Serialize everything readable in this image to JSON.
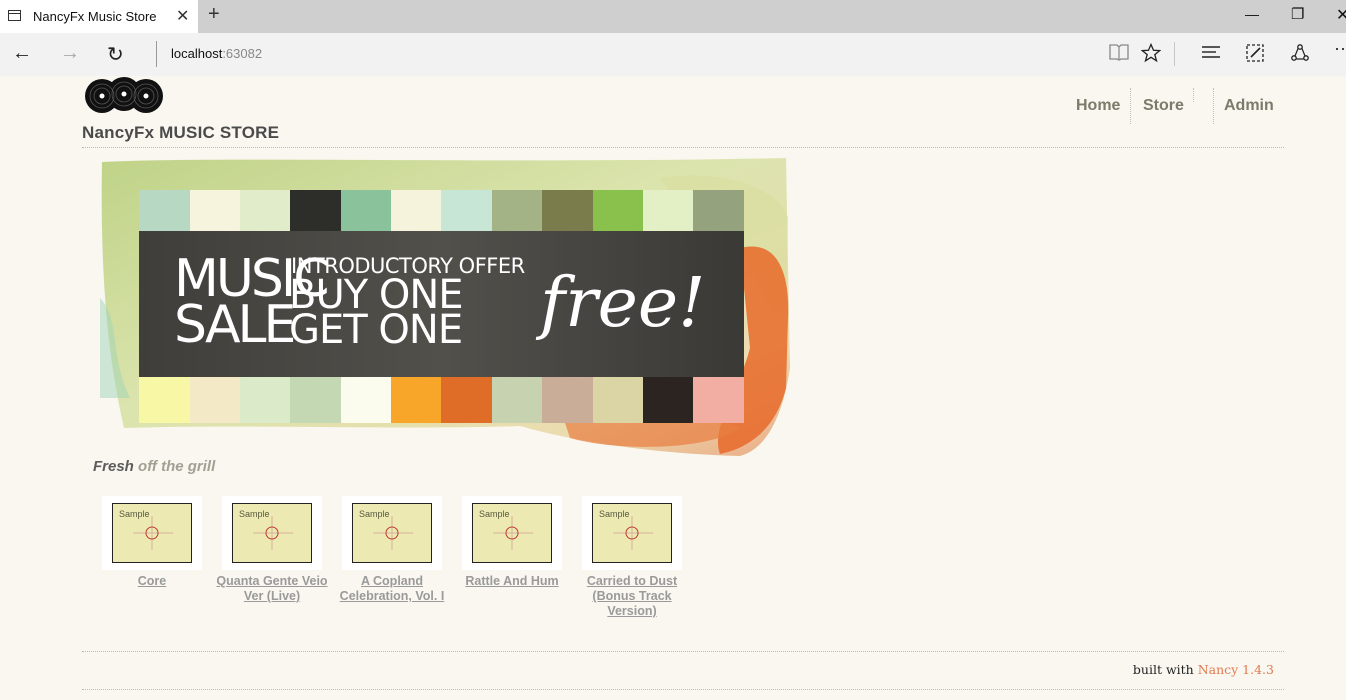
{
  "browser": {
    "tab_title": "NancyFx Music Store",
    "address_host": "localhost",
    "address_port": ":63082",
    "icons": {
      "back": "arrow-left-icon",
      "forward": "arrow-right-icon",
      "refresh": "refresh-icon",
      "reading_view": "book-icon",
      "favorites": "star-icon",
      "hub": "hub-icon",
      "web_note": "pen-icon",
      "share": "share-icon",
      "more": "more-icon"
    }
  },
  "site": {
    "title": "NancyFx MUSIC STORE",
    "menu": [
      "Home",
      "Store",
      "Admin"
    ]
  },
  "banner": {
    "line_left_1": "MUSIC",
    "line_left_2": "SALE",
    "line_top": "INTRODUCTORY OFFER",
    "line_mid": "BUY ONE",
    "line_bottom": "GET ONE",
    "script": "free!"
  },
  "section": {
    "title_strong": "Fresh",
    "title_rest": " off the grill"
  },
  "albums": [
    {
      "title": "Core",
      "thumb_label": "Sample"
    },
    {
      "title": "Quanta Gente Veio Ver (Live)",
      "thumb_label": "Sample"
    },
    {
      "title": "A Copland Celebration, Vol. I",
      "thumb_label": "Sample"
    },
    {
      "title": "Rattle And Hum",
      "thumb_label": "Sample"
    },
    {
      "title": "Carried to Dust (Bonus Track Version)",
      "thumb_label": "Sample"
    }
  ],
  "footer": {
    "prefix": "built with ",
    "brand": "Nancy 1.4.3"
  },
  "colors": {
    "page_bg": "#f9f7f0",
    "menu_text": "#7b7b6a",
    "footer_brand": "#e07b50",
    "album_link": "#9a9a9a"
  }
}
